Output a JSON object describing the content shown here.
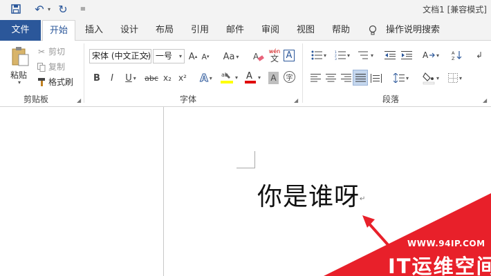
{
  "window": {
    "title": "文档1 [兼容模式]"
  },
  "quick_access": {
    "save": "save-icon",
    "undo": "undo-icon",
    "redo": "redo-icon",
    "customize": "customize-icon"
  },
  "tabs": {
    "file": "文件",
    "home": "开始",
    "items": [
      "插入",
      "设计",
      "布局",
      "引用",
      "邮件",
      "审阅",
      "视图",
      "帮助"
    ],
    "tell_me": "操作说明搜索"
  },
  "clipboard": {
    "paste": "粘贴",
    "cut": "剪切",
    "copy": "复制",
    "format_painter": "格式刷",
    "group_label": "剪贴板"
  },
  "font": {
    "family": "宋体 (中文正文)",
    "size": "一号",
    "bold": "B",
    "italic": "I",
    "underline": "U",
    "strikethrough": "abc",
    "subscript": "x₂",
    "superscript": "x²",
    "grow": "A",
    "shrink": "A",
    "change_case": "Aa",
    "phonetic": "wén",
    "phonetic_char": "文",
    "border_char": "A",
    "shading_char": "A",
    "enclose_char": "字",
    "group_label": "字体"
  },
  "paragraph": {
    "group_label": "段落"
  },
  "document": {
    "text": "你是谁呀",
    "para_mark": "↵"
  },
  "watermark": {
    "url": "WWW.94IP.COM",
    "name": "IT运维空间"
  },
  "colors": {
    "accent": "#2b579a",
    "highlight": "#ffff00",
    "font_color": "#e00000",
    "watermark": "#e8202a"
  }
}
